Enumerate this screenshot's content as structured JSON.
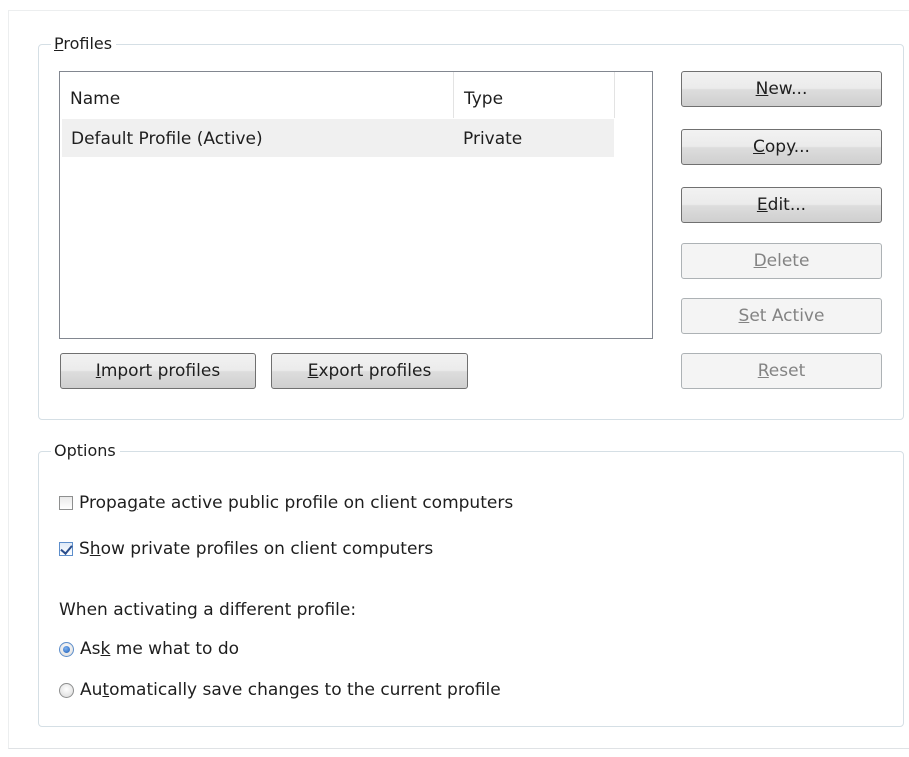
{
  "profiles_group": {
    "legend_hotkey": "P",
    "legend_rest": "rofiles",
    "columns": {
      "name": "Name",
      "type": "Type"
    },
    "rows": [
      {
        "name": "Default Profile (Active)",
        "type": "Private",
        "selected": true
      }
    ],
    "buttons": {
      "new": {
        "pre": "",
        "key": "N",
        "post": "ew...",
        "enabled": true
      },
      "copy": {
        "pre": "",
        "key": "C",
        "post": "opy...",
        "enabled": true
      },
      "edit": {
        "pre": "",
        "key": "E",
        "post": "dit...",
        "enabled": true
      },
      "delete": {
        "pre": "",
        "key": "D",
        "post": "elete",
        "enabled": false
      },
      "set_active": {
        "pre": "",
        "key": "S",
        "post": "et Active",
        "enabled": false
      },
      "reset": {
        "pre": "",
        "key": "R",
        "post": "eset",
        "enabled": false
      },
      "import": {
        "pre": "",
        "key": "I",
        "post": "mport profiles",
        "enabled": true
      },
      "export": {
        "pre": "",
        "key": "E",
        "post": "xport profiles",
        "enabled": true
      }
    }
  },
  "options_group": {
    "legend": "Options",
    "propagate": {
      "pre": "Propa",
      "key": "g",
      "post": "ate active public profile on client computers",
      "checked": false
    },
    "show_private": {
      "pre": "S",
      "key": "h",
      "post": "ow private profiles on client computers",
      "checked": true
    },
    "activation_prompt": "When activating a different profile:",
    "radio_ask": {
      "pre": "As",
      "key": "k",
      "post": " me what to do",
      "selected": true
    },
    "radio_auto": {
      "pre": "Au",
      "key": "t",
      "post": "omatically save changes to the current profile",
      "selected": false
    }
  },
  "colors": {
    "group_border": "#d5dfe5",
    "list_border": "#828790",
    "selected_row": "#f0f0f0",
    "disabled_text": "#838383",
    "button_border": "#707070"
  }
}
